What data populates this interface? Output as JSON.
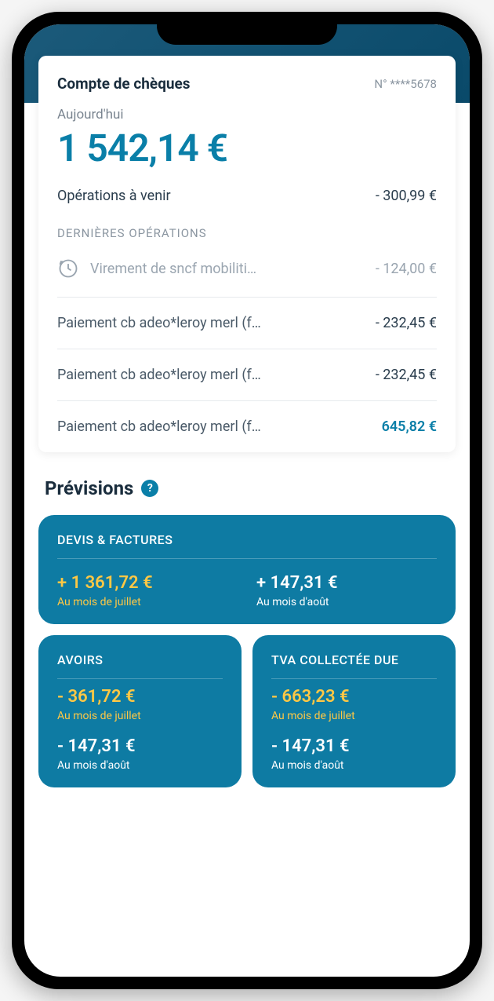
{
  "account": {
    "title": "Compte de chèques",
    "number": "N° ****5678",
    "today_label": "Aujourd'hui",
    "balance": "1 542,14 €",
    "pending_label": "Opérations à venir",
    "pending_amount": "- 300,99 €"
  },
  "operations": {
    "section_label": "DERNIÈRES OPÉRATIONS",
    "items": [
      {
        "label": "Virement de sncf mobiliti…",
        "amount": "- 124,00 €",
        "pending": true
      },
      {
        "label": "Paiement cb adeo*leroy merl (f…",
        "amount": "- 232,45 €",
        "pending": false
      },
      {
        "label": "Paiement cb adeo*leroy merl (f…",
        "amount": "- 232,45 €",
        "pending": false
      },
      {
        "label": "Paiement cb adeo*leroy merl (f…",
        "amount": "645,82 €",
        "pending": false,
        "positive": true
      }
    ]
  },
  "forecasts": {
    "title": "Prévisions",
    "tiles": {
      "devis": {
        "title": "DEVIS & FACTURES",
        "m1_value": "+ 1 361,72 €",
        "m1_period": "Au mois de juillet",
        "m2_value": "+ 147,31 €",
        "m2_period": "Au mois d'août"
      },
      "avoirs": {
        "title": "AVOIRS",
        "m1_value": "- 361,72 €",
        "m1_period": "Au mois de juillet",
        "m2_value": "- 147,31 €",
        "m2_period": "Au mois d'août"
      },
      "tva": {
        "title": "TVA COLLECTÉE DUE",
        "m1_value": "- 663,23 €",
        "m1_period": "Au mois de juillet",
        "m2_value": "- 147,31 €",
        "m2_period": "Au mois d'août"
      }
    }
  }
}
